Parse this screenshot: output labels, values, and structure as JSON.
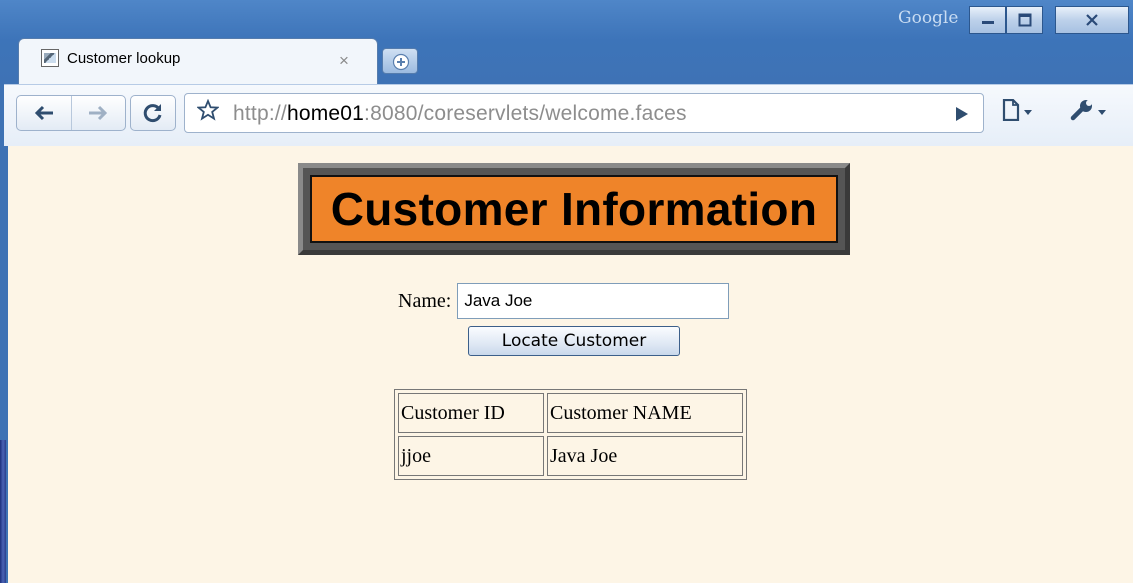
{
  "window": {
    "branding": "Google",
    "controls": [
      "minimize",
      "maximize",
      "close"
    ]
  },
  "tab": {
    "title": "Customer lookup",
    "close_glyph": "×",
    "favicon": "page-favicon"
  },
  "toolbar": {
    "back_icon": "back-arrow-icon",
    "forward_icon": "forward-arrow-icon",
    "reload_icon": "reload-icon",
    "bookmark_icon": "star-icon",
    "url_prefix": "http://",
    "url_host": "home01",
    "url_rest": ":8080/coreservlets/welcome.faces",
    "go_icon": "play-icon",
    "page_icon": "page-menu-icon",
    "tools_icon": "wrench-icon"
  },
  "page": {
    "banner_title": "Customer Information",
    "name_label": "Name:",
    "name_value": "Java Joe",
    "locate_button": "Locate Customer",
    "table": {
      "headers": [
        "Customer ID",
        "Customer NAME"
      ],
      "rows": [
        [
          "jjoe",
          "Java Joe"
        ]
      ]
    }
  },
  "colors": {
    "page_background": "#fdf5e6",
    "banner_fill": "#ef8429",
    "frame_blue": "#3d74b9"
  }
}
